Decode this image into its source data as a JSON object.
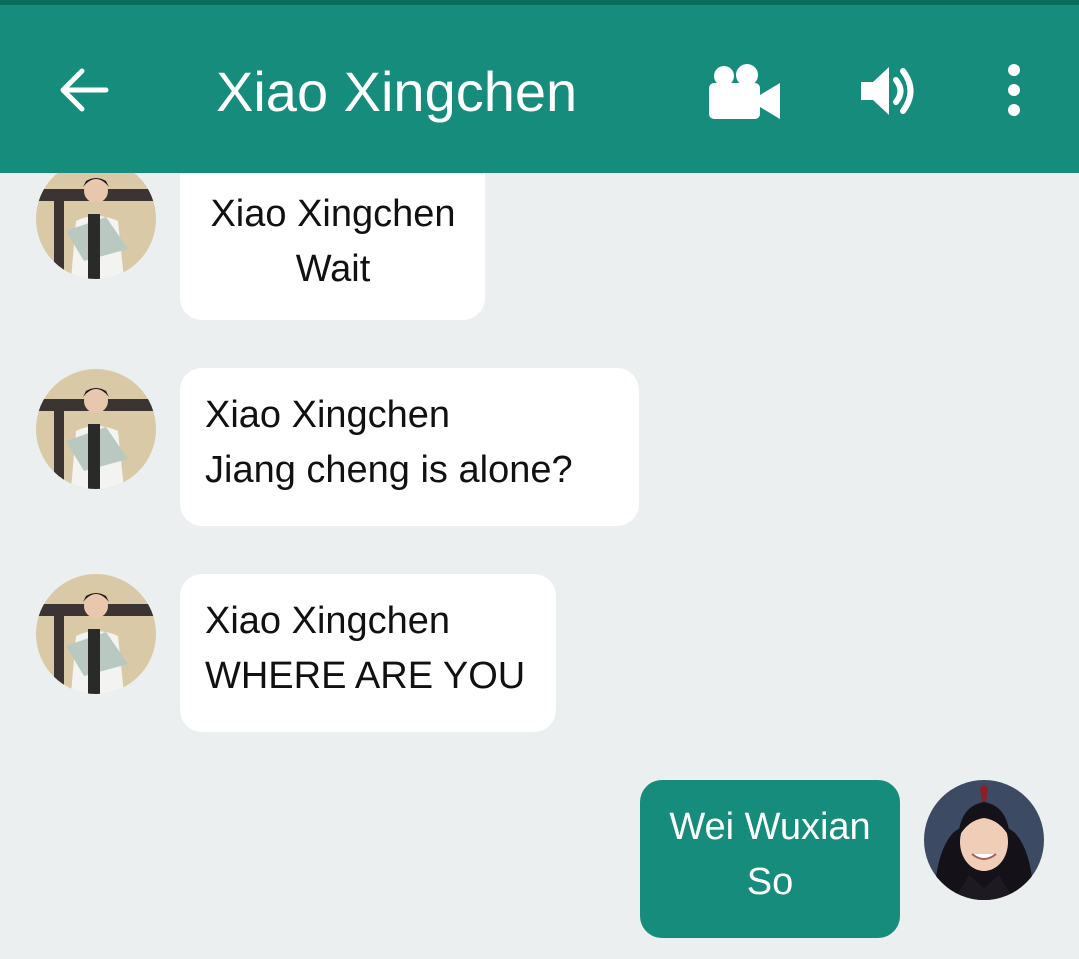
{
  "header": {
    "title": "Xiao Xingchen",
    "back_icon": "arrow-left-icon",
    "actions": [
      {
        "name": "video-call",
        "icon": "video-camera-icon"
      },
      {
        "name": "voice-call",
        "icon": "speaker-icon"
      },
      {
        "name": "more",
        "icon": "more-vertical-icon"
      }
    ],
    "color": "#158c7c"
  },
  "messages": [
    {
      "direction": "incoming",
      "sender": "Xiao Xingchen",
      "text": "Wait"
    },
    {
      "direction": "incoming",
      "sender": "Xiao Xingchen",
      "text": "Jiang cheng is alone?"
    },
    {
      "direction": "incoming",
      "sender": "Xiao Xingchen",
      "text": "WHERE ARE YOU"
    },
    {
      "direction": "outgoing",
      "sender": "Wei Wuxian",
      "text": "So"
    }
  ],
  "colors": {
    "background": "#ebeff0",
    "incoming_bubble": "#ffffff",
    "outgoing_bubble": "#158c7c"
  }
}
